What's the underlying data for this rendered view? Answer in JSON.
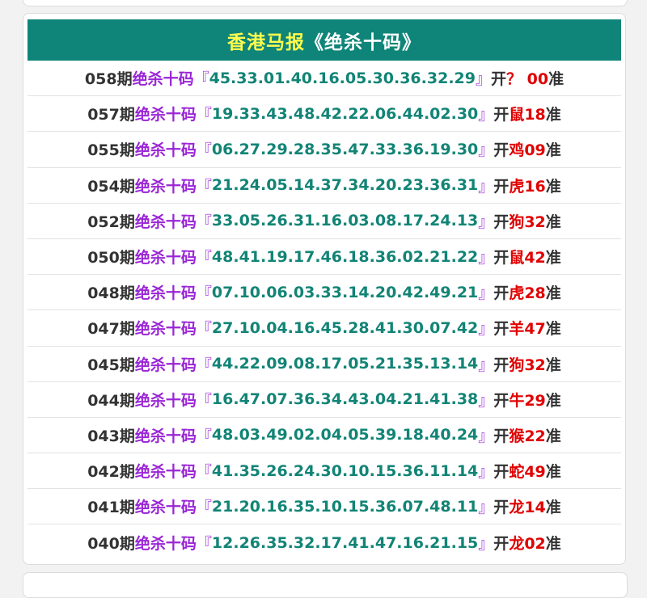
{
  "header": {
    "title_part1": "香港马报",
    "title_part2": "《绝杀十码》"
  },
  "label_kill": "绝杀十码",
  "label_open": "开",
  "label_zhun": "准",
  "bracket_open": "『",
  "bracket_close": "』",
  "rows": [
    {
      "period": "058期",
      "numbers": "45.33.01.40.16.05.30.36.32.29",
      "result": "？ 00"
    },
    {
      "period": "057期",
      "numbers": "19.33.43.48.42.22.06.44.02.30",
      "result": "鼠18"
    },
    {
      "period": "055期",
      "numbers": "06.27.29.28.35.47.33.36.19.30",
      "result": "鸡09"
    },
    {
      "period": "054期",
      "numbers": "21.24.05.14.37.34.20.23.36.31",
      "result": "虎16"
    },
    {
      "period": "052期",
      "numbers": "33.05.26.31.16.03.08.17.24.13",
      "result": "狗32"
    },
    {
      "period": "050期",
      "numbers": "48.41.19.17.46.18.36.02.21.22",
      "result": "鼠42"
    },
    {
      "period": "048期",
      "numbers": "07.10.06.03.33.14.20.42.49.21",
      "result": "虎28"
    },
    {
      "period": "047期",
      "numbers": "27.10.04.16.45.28.41.30.07.42",
      "result": "羊47"
    },
    {
      "period": "045期",
      "numbers": "44.22.09.08.17.05.21.35.13.14",
      "result": "狗32"
    },
    {
      "period": "044期",
      "numbers": "16.47.07.36.34.43.04.21.41.38",
      "result": "牛29"
    },
    {
      "period": "043期",
      "numbers": "48.03.49.02.04.05.39.18.40.24",
      "result": "猴22"
    },
    {
      "period": "042期",
      "numbers": "41.35.26.24.30.10.15.36.11.14",
      "result": "蛇49"
    },
    {
      "period": "041期",
      "numbers": "21.20.16.35.10.15.36.07.48.11",
      "result": "龙14"
    },
    {
      "period": "040期",
      "numbers": "12.26.35.32.17.41.47.16.21.15",
      "result": "龙02"
    }
  ]
}
